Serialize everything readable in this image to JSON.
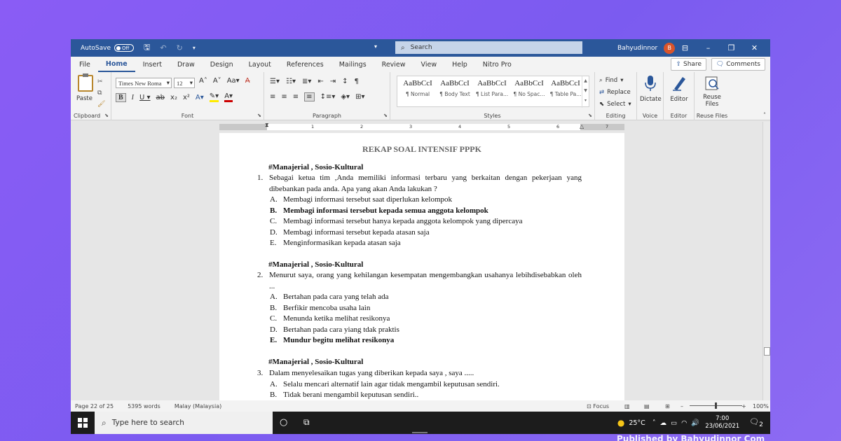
{
  "titlebar": {
    "autosave_label": "AutoSave",
    "autosave_state": "Off",
    "search_label": "Search",
    "user_name": "Bahyudinnor",
    "user_initial": "B"
  },
  "tabs": [
    "File",
    "Home",
    "Insert",
    "Draw",
    "Design",
    "Layout",
    "References",
    "Mailings",
    "Review",
    "View",
    "Help",
    "Nitro Pro"
  ],
  "active_tab": "Home",
  "share_label": "Share",
  "comments_label": "Comments",
  "ribbon": {
    "paste_label": "Paste",
    "font_name": "Times New Roma",
    "font_size": "12",
    "styles": [
      {
        "sample": "AaBbCcI",
        "name": "¶ Normal"
      },
      {
        "sample": "AaBbCcI",
        "name": "¶ Body Text"
      },
      {
        "sample": "AaBbCcI",
        "name": "¶ List Para..."
      },
      {
        "sample": "AaBbCcI",
        "name": "¶ No Spac..."
      },
      {
        "sample": "AaBbCcI",
        "name": "¶ Table Pa..."
      }
    ],
    "find_label": "Find",
    "replace_label": "Replace",
    "select_label": "Select",
    "dictate_label": "Dictate",
    "editor_label": "Editor",
    "reuse_line1": "Reuse",
    "reuse_line2": "Files",
    "groups": {
      "clipboard": "Clipboard",
      "font": "Font",
      "paragraph": "Paragraph",
      "styles": "Styles",
      "editing": "Editing",
      "voice": "Voice",
      "editor": "Editor",
      "reuse": "Reuse Files"
    }
  },
  "ruler_numbers": [
    "1",
    "1",
    "2",
    "3",
    "4",
    "5",
    "6",
    "7"
  ],
  "document": {
    "title": "REKAP SOAL INTENSIF PPPK",
    "q1": {
      "heading": "#Manajerial , Sosio-Kultural",
      "number": "1.",
      "text": "Sebagai ketua tim ,Anda memiliki informasi terbaru yang berkaitan dengan pekerjaan yang dibebankan pada anda. Apa yang akan Anda lakukan ?",
      "options": [
        {
          "letter": "A.",
          "text": "Membagi informasi tersebut saat diperlukan kelompok"
        },
        {
          "letter": "B.",
          "text": "Membagi informasi tersebut kepada semua anggota kelompok"
        },
        {
          "letter": "C.",
          "text": "Membagi informasi tersebut hanya kepada anggota kelompok yang dipercaya"
        },
        {
          "letter": "D.",
          "text": "Membagi informasi tersebut kepada atasan saja"
        },
        {
          "letter": "E.",
          "text": "Menginformasikan kepada atasan saja"
        }
      ]
    },
    "q2": {
      "heading": "#Manajerial , Sosio-Kultural",
      "number": "2.",
      "text": "Menurut saya, orang yang kehilangan kesempatan mengembangkan usahanya lebihdisebabkan oleh ...",
      "options": [
        {
          "letter": "A.",
          "text": "Bertahan pada cara yang telah ada"
        },
        {
          "letter": "B.",
          "text": "Berfikir mencoba usaha lain"
        },
        {
          "letter": "C.",
          "text": "Menunda ketika melihat resikonya"
        },
        {
          "letter": "D.",
          "text": "Bertahan pada cara yiang tdak praktis"
        },
        {
          "letter": "E.",
          "text": "Mundur begitu melihat resikonya"
        }
      ]
    },
    "q3": {
      "heading": "#Manajerial , Sosio-Kultural",
      "number": "3.",
      "text": "Dalam menyelesaikan tugas yang diberikan kepada saya , saya .....",
      "options": [
        {
          "letter": "A.",
          "text": "Selalu mencari alternatif lain agar tidak mengambil keputusan sendiri."
        },
        {
          "letter": "B.",
          "text": "Tidak berani mengambil keputusan sendiri.."
        }
      ]
    }
  },
  "statusbar": {
    "page": "Page 22 of 25",
    "words": "5395 words",
    "language": "Malay (Malaysia)",
    "focus": "Focus",
    "zoom": "100%",
    "zoom_fraction": 0.5
  },
  "taskbar": {
    "search_placeholder": "Type here to search",
    "temperature": "25°C",
    "time": "7:00",
    "date": "23/06/2021",
    "notifications": "2"
  },
  "watermark": "Published by Bahyudinnor Com"
}
